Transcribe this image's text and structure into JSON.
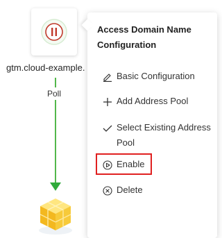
{
  "node": {
    "domain_label": "gtm.cloud-example.",
    "status_icon": "pause-circle-icon"
  },
  "edge": {
    "label": "Poll",
    "color": "#52b74a"
  },
  "pool": {
    "icon": "address-pool-cube-icon"
  },
  "menu": {
    "title": "Access Domain Name Configuration",
    "items": [
      {
        "label": "Basic Configuration",
        "icon": "edit-icon"
      },
      {
        "label": "Add Address Pool",
        "icon": "plus-icon"
      },
      {
        "label": "Select Existing Address Pool",
        "icon": "check-icon"
      },
      {
        "label": "Enable",
        "icon": "play-circle-icon"
      },
      {
        "label": "Delete",
        "icon": "close-circle-icon"
      }
    ],
    "highlight_color": "#e02020"
  }
}
